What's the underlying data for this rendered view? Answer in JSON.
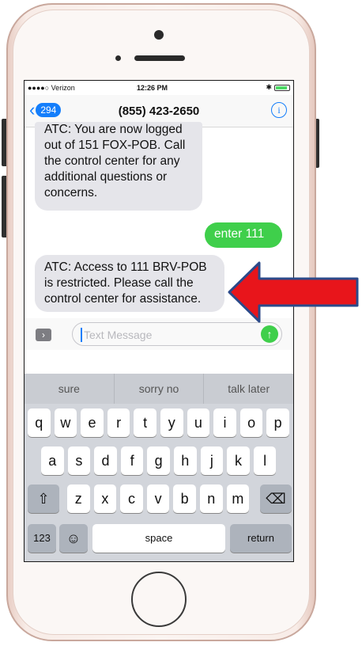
{
  "status": {
    "carrier": "●●●●○ Verizon",
    "time": "12:26 PM",
    "bluetooth": "✱"
  },
  "nav": {
    "back_count": "294",
    "title": "(855) 423-2650",
    "info": "i"
  },
  "messages": [
    {
      "direction": "in",
      "text": "ATC: You are now logged out of 151  FOX-POB. Call the control center for any additional questions or concerns."
    },
    {
      "direction": "out",
      "text": "enter 111"
    },
    {
      "direction": "in",
      "text": "ATC: Access to 111  BRV-POB is restricted. Please call the control center for assistance."
    }
  ],
  "composer": {
    "placeholder": "Text Message",
    "send": "↑",
    "apps": "›"
  },
  "predictions": [
    "sure",
    "sorry no",
    "talk later"
  ],
  "keyboard": {
    "row1": [
      "q",
      "w",
      "e",
      "r",
      "t",
      "y",
      "u",
      "i",
      "o",
      "p"
    ],
    "row2": [
      "a",
      "s",
      "d",
      "f",
      "g",
      "h",
      "j",
      "k",
      "l"
    ],
    "row3": [
      "z",
      "x",
      "c",
      "v",
      "b",
      "n",
      "m"
    ],
    "shift": "⇧",
    "delete": "⌫",
    "numbers": "123",
    "emoji": "☺",
    "space": "space",
    "return": "return"
  },
  "colors": {
    "accent": "#147efb",
    "outgoing": "#3fcf4b",
    "incoming": "#e5e5ea",
    "arrow": "#e8151b",
    "arrow_outline": "#2b4a8a"
  },
  "icons": {
    "back": "chevron-left-icon",
    "info": "info-icon",
    "send": "arrow-up-icon",
    "arrow": "big-red-arrow-left-icon"
  }
}
